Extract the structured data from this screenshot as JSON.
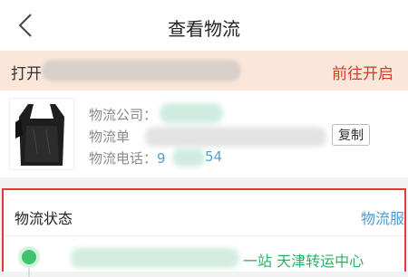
{
  "header": {
    "title": "查看物流",
    "back_icon": "chevron-left-icon"
  },
  "notice": {
    "text": "打开",
    "action": "前往开启",
    "action_color": "#d23c2c"
  },
  "logistics_info": {
    "company_label": "物流公司：",
    "tracking_label": "物流单",
    "phone_label": "物流电话：",
    "phone_value_start": "9",
    "phone_value_end": "54",
    "copy_button": "复制"
  },
  "status": {
    "title": "物流状态",
    "service_link": "物流服",
    "latest_event": "一站 天津转运中心",
    "active_color": "#3cc36b"
  }
}
